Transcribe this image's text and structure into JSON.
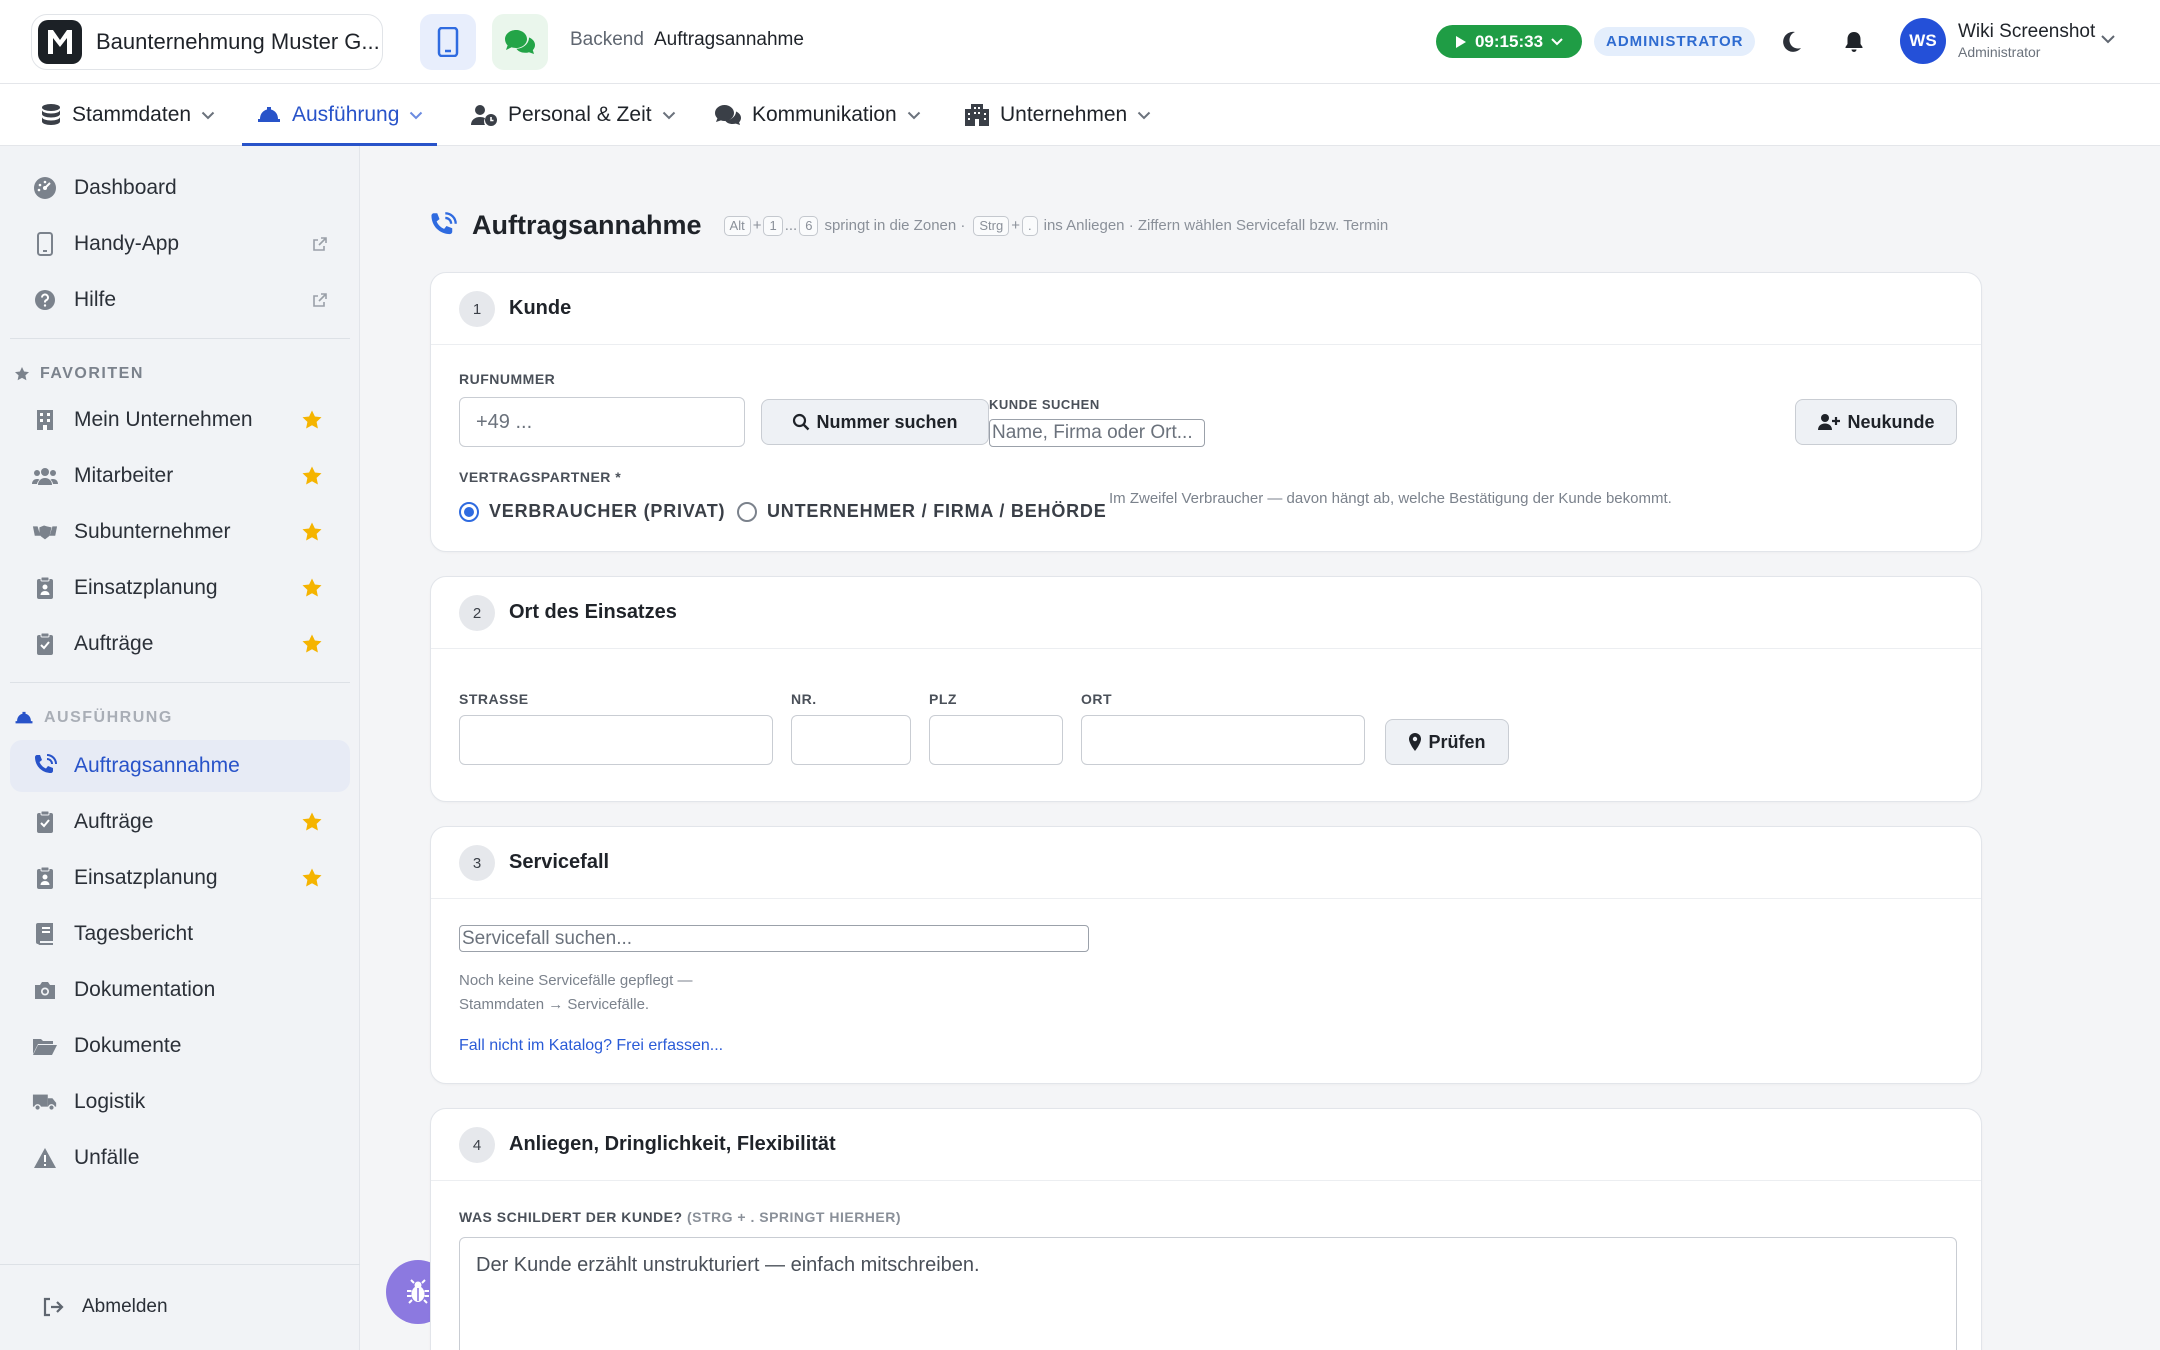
{
  "app": {
    "company": "Baunternehmung Muster G...",
    "logo_letter": "M"
  },
  "breadcrumb": {
    "section": "Backend",
    "page": "Auftragsannahme"
  },
  "timer": "09:15:33",
  "role_badge": "ADMINISTRATOR",
  "user": {
    "name": "Wiki Screenshot",
    "role": "Administrator",
    "initials": "WS"
  },
  "nav": [
    {
      "label": "Stammdaten"
    },
    {
      "label": "Ausführung"
    },
    {
      "label": "Personal & Zeit"
    },
    {
      "label": "Kommunikation"
    },
    {
      "label": "Unternehmen"
    }
  ],
  "sidebar": {
    "top": [
      {
        "label": "Dashboard"
      },
      {
        "label": "Handy-App"
      },
      {
        "label": "Hilfe"
      }
    ],
    "favorites_title": "FAVORITEN",
    "favorites": [
      {
        "label": "Mein Unternehmen"
      },
      {
        "label": "Mitarbeiter"
      },
      {
        "label": "Subunternehmer"
      },
      {
        "label": "Einsatzplanung"
      },
      {
        "label": "Aufträge"
      }
    ],
    "section_title": "AUSFÜHRUNG",
    "section_items": [
      {
        "label": "Auftragsannahme"
      },
      {
        "label": "Aufträge"
      },
      {
        "label": "Einsatzplanung"
      },
      {
        "label": "Tagesbericht"
      },
      {
        "label": "Dokumentation"
      },
      {
        "label": "Dokumente"
      },
      {
        "label": "Logistik"
      },
      {
        "label": "Unfälle"
      }
    ],
    "logout": "Abmelden"
  },
  "page": {
    "title": "Auftragsannahme",
    "hint": {
      "k_alt": "Alt",
      "plus": "+",
      "k_1": "1",
      "dots": "...",
      "k_6": "6",
      "text1": "springt in die Zonen ·",
      "k_strg": "Strg",
      "k_dot": ".",
      "text2": "ins Anliegen · Ziffern wählen Servicefall bzw. Termin"
    }
  },
  "card1": {
    "num": "1",
    "title": "Kunde",
    "phone_label": "RUFNUMMER",
    "phone_placeholder": "+49 ...",
    "search_number_btn": "Nummer suchen",
    "customer_label": "KUNDE SUCHEN",
    "customer_placeholder": "Name, Firma oder Ort...",
    "new_customer_btn": "Neukunde",
    "partner_label": "VERTRAGSPARTNER *",
    "radio_private": "VERBRAUCHER (PRIVAT)",
    "radio_business": "UNTERNEHMER / FIRMA / BEHÖRDE",
    "partner_note": "Im Zweifel Verbraucher — davon hängt ab, welche Bestätigung der Kunde bekommt."
  },
  "card2": {
    "num": "2",
    "title": "Ort des Einsatzes",
    "street_label": "STRASSE",
    "nr_label": "NR.",
    "zip_label": "PLZ",
    "city_label": "ORT",
    "check_btn": "Prüfen"
  },
  "card3": {
    "num": "3",
    "title": "Servicefall",
    "search_placeholder": "Servicefall suchen...",
    "empty_line1": "Noch keine Servicefälle gepflegt —",
    "empty_line2": "Stammdaten → Servicefälle.",
    "free_link": "Fall nicht im Katalog? Frei erfassen..."
  },
  "card4": {
    "num": "4",
    "title": "Anliegen, Dringlichkeit, Flexibilität",
    "desc_label": "WAS SCHILDERT DER KUNDE?",
    "desc_hint": "(STRG + . SPRINGT HIERHER)",
    "desc_placeholder": "Der Kunde erzählt unstrukturiert — einfach mitschreiben."
  },
  "colors": {
    "accent": "#2853c9",
    "timer": "#1f9d45",
    "star": "#f5b400",
    "fab": "#8c79e0"
  }
}
